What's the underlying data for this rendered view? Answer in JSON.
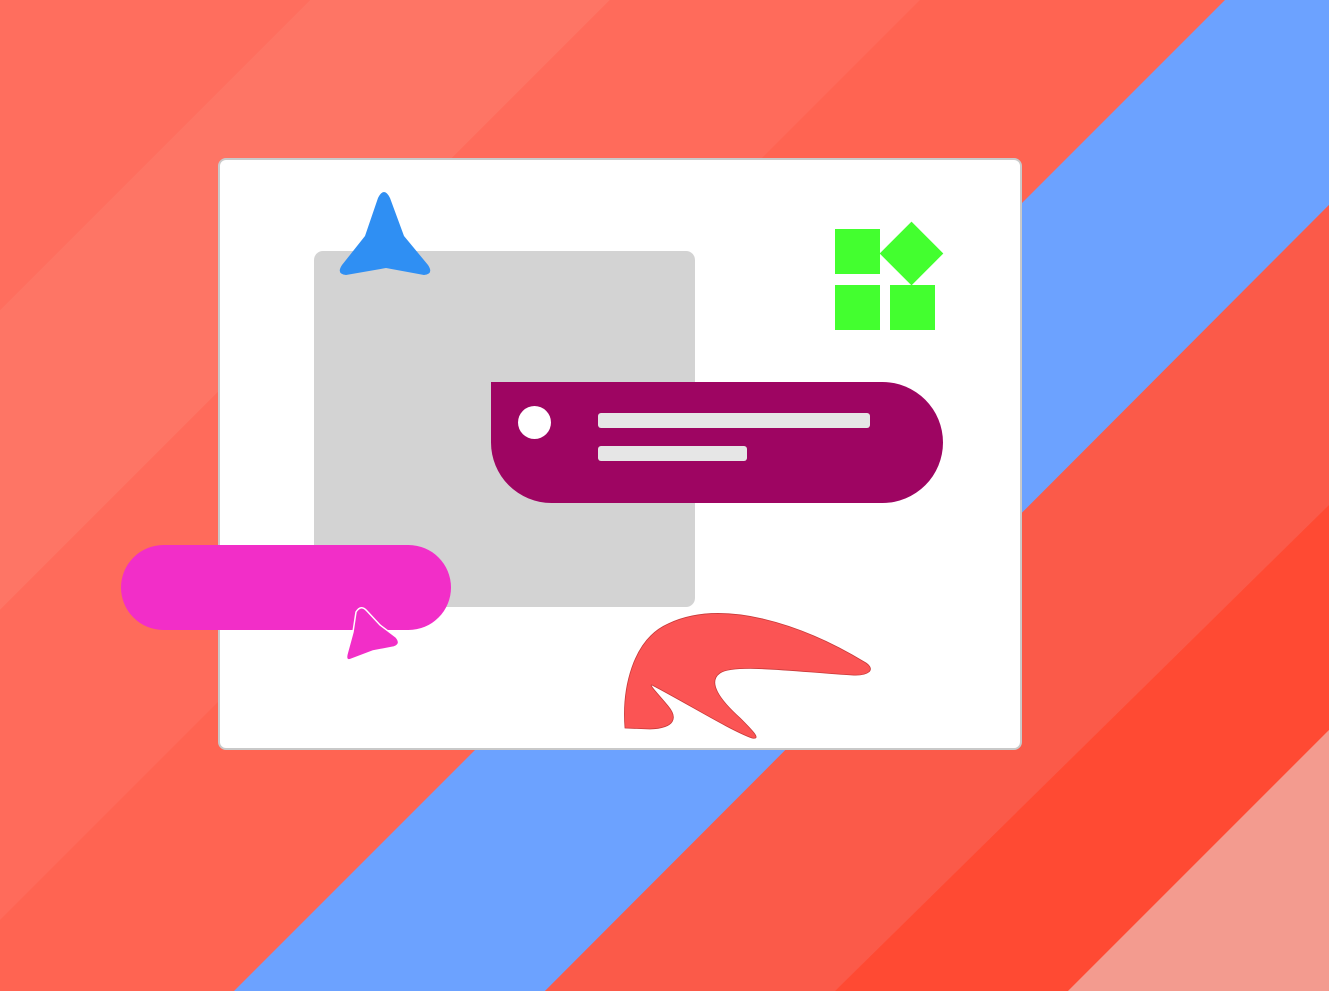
{
  "colors": {
    "card_background": "#ffffff",
    "panel_gray": "#d3d3d3",
    "notification_purple": "#9e0562",
    "pill_pink": "#f22ec8",
    "arrow_blue": "#2f8ff3",
    "grid_green": "#43ff2f",
    "blob_red": "#fb5454",
    "stripe_blue": "#6ca2ff",
    "stripe_red": "#ff6452",
    "stripe_deep_red": "#ff4a33",
    "stripe_salmon": "#f39b8f"
  },
  "icons": {
    "top_arrow": "navigation-arrow-icon",
    "grid": "apps-grid-icon",
    "cursor": "cursor-arrow-icon",
    "blob": "abstract-blob-shape"
  }
}
